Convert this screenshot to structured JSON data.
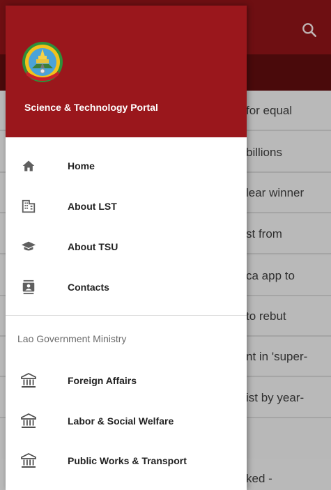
{
  "background": {
    "toolbar_color": "#6e0f12",
    "search_icon": "search-icon",
    "news_rows": [
      "for equal",
      "billions",
      "lear winner",
      "st from",
      "ca app to",
      "to rebut",
      "nt in 'super-",
      "ist by year-",
      "ked -"
    ]
  },
  "drawer": {
    "header_color": "#9a171c",
    "emblem": "lao-emblem-logo",
    "title": "Science & Technology Portal",
    "items": [
      {
        "label": "Home",
        "icon": "home-icon"
      },
      {
        "label": "About LST",
        "icon": "building-icon"
      },
      {
        "label": "About TSU",
        "icon": "graduation-cap-icon"
      },
      {
        "label": "Contacts",
        "icon": "contacts-icon"
      }
    ],
    "section_header": "Lao Government Ministry",
    "ministries": [
      {
        "label": "Foreign Affairs",
        "icon": "ministry-building-icon"
      },
      {
        "label": "Labor & Social Welfare",
        "icon": "ministry-building-icon"
      },
      {
        "label": "Public Works & Transport",
        "icon": "ministry-building-icon"
      }
    ]
  }
}
